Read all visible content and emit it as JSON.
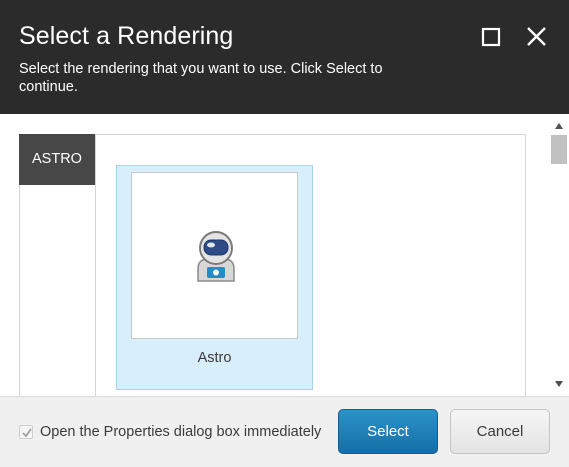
{
  "dialog": {
    "title": "Select a Rendering",
    "subtitle": "Select the rendering that you want to use. Click Select to continue.",
    "maximize_icon": "maximize-icon",
    "close_icon": "close-icon"
  },
  "categories": [
    {
      "label": "ASTRO",
      "selected": true
    }
  ],
  "renderings": [
    {
      "label": "Astro",
      "icon": "astronaut-icon",
      "selected": true
    }
  ],
  "footer": {
    "checkbox_label": "Open the Properties dialog box immediately",
    "checkbox_checked": true,
    "select_label": "Select",
    "cancel_label": "Cancel"
  },
  "colors": {
    "header_bg": "#2b2b2b",
    "category_bg": "#474747",
    "tile_selected_bg": "#d9eefb",
    "primary_button": "#1f80b8"
  }
}
